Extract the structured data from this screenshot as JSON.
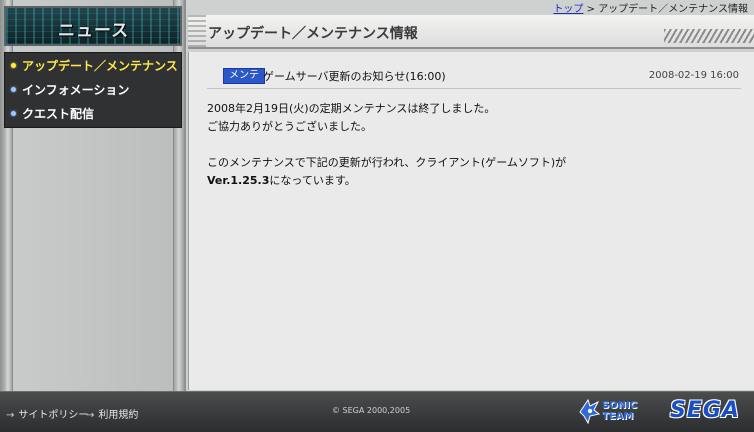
{
  "sidebar": {
    "logo_title": "ニュース",
    "items": [
      {
        "label": "アップデート／メンテナンス",
        "active": true
      },
      {
        "label": "インフォメーション",
        "active": false
      },
      {
        "label": "クエスト配信",
        "active": false
      }
    ]
  },
  "breadcrumb": {
    "home": "トップ",
    "separator": ">",
    "current": "アップデート／メンテナンス情報"
  },
  "header": {
    "title": "アップデート／メンテナンス情報"
  },
  "news": {
    "badge": "メンテ",
    "title": "ゲームサーバ更新のお知らせ(16:00)",
    "date": "2008-02-19 16:00",
    "body": {
      "line1": "2008年2月19日(火)の定期メンテナンスは終了しました。",
      "line2": "ご協力ありがとうございました。",
      "line3": "このメンテナンスで下記の更新が行われ、クライアント(ゲームソフト)が",
      "version": "Ver.1.25.3",
      "line4_suffix": "になっています。"
    }
  },
  "footer": {
    "site_policy": "サイトポリシー",
    "terms": "利用規約",
    "copyright": "© SEGA 2000,2005",
    "sonic_team": "SONIC TEAM",
    "sega": "SEGA"
  },
  "colors": {
    "accent_yellow": "#ffe84a",
    "badge_blue": "#2a58c9",
    "link_blue": "#1a2fb5"
  }
}
